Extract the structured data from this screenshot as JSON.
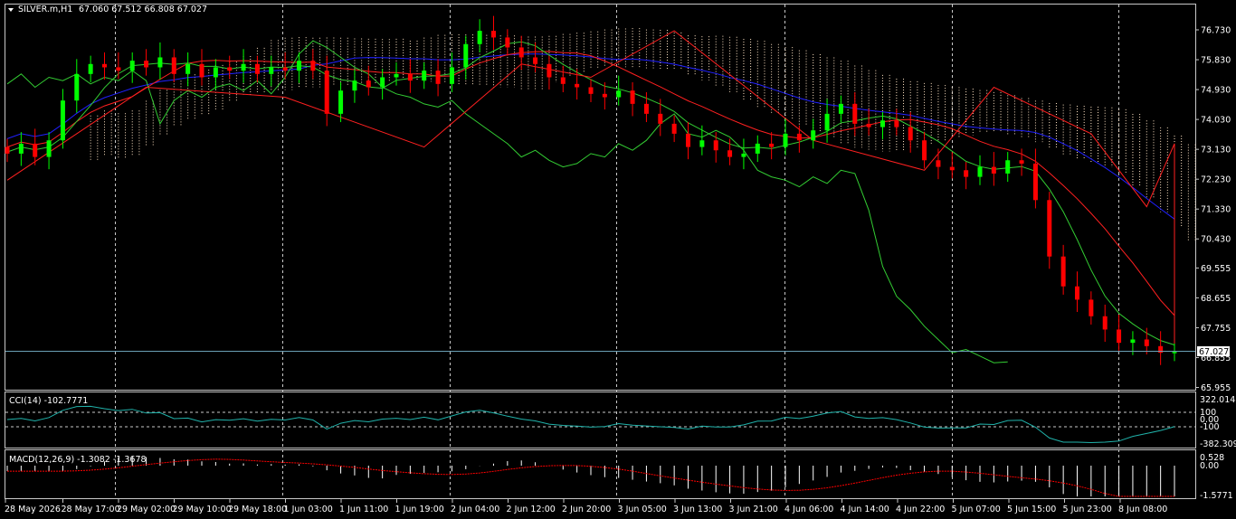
{
  "header": {
    "symbol": "SILVER.m,H1",
    "ohlc": "67.060 67.512 66.808 67.027",
    "menu_icon": "triangle-down-icon"
  },
  "price_axis": {
    "labels": [
      "76.730",
      "75.830",
      "74.930",
      "74.030",
      "73.130",
      "72.230",
      "71.330",
      "70.430",
      "69.555",
      "68.655",
      "67.755",
      "66.855",
      "65.955"
    ],
    "current": "67.027"
  },
  "cci": {
    "title": "CCI(14) -102.7771",
    "labels": [
      "322.0148",
      "100",
      "0.00",
      "-100",
      "-382.309"
    ]
  },
  "macd": {
    "title": "MACD(12,26,9) -1.3082 -1.3678",
    "labels": [
      "0.528",
      "0.00",
      "-1.5771"
    ]
  },
  "time_axis": {
    "labels": [
      "28 May 2026",
      "28 May 17:00",
      "29 May 02:00",
      "29 May 10:00",
      "29 May 18:00",
      "1 Jun 03:00",
      "1 Jun 11:00",
      "1 Jun 19:00",
      "2 Jun 04:00",
      "2 Jun 12:00",
      "2 Jun 20:00",
      "3 Jun 05:00",
      "3 Jun 13:00",
      "3 Jun 21:00",
      "4 Jun 06:00",
      "4 Jun 14:00",
      "4 Jun 22:00",
      "5 Jun 07:00",
      "5 Jun 15:00",
      "5 Jun 23:00",
      "8 Jun 08:00"
    ]
  },
  "colors": {
    "background": "#000000",
    "bull": "#00ff00",
    "bear": "#ff0000",
    "grid": "#c8c8c8",
    "cloud": "#ffe4c4",
    "line_blue": "#2020ff",
    "line_red": "#ff2020",
    "line_green": "#33cc33",
    "cci": "#20b2aa",
    "macd_hist": "#ffffff",
    "macd_signal": "#ff0000",
    "current_line": "#6a9fb5"
  },
  "chart_data": {
    "type": "candlestick",
    "instrument": "SILVER.m",
    "timeframe": "H1",
    "close": [
      73.0,
      73.3,
      72.9,
      73.4,
      74.6,
      75.4,
      75.7,
      75.6,
      75.5,
      75.8,
      75.6,
      75.9,
      75.4,
      75.7,
      75.3,
      75.6,
      75.5,
      75.7,
      75.4,
      75.6,
      75.5,
      75.8,
      75.5,
      74.2,
      74.9,
      75.2,
      75.0,
      75.3,
      75.4,
      75.2,
      75.5,
      75.1,
      75.6,
      76.3,
      76.7,
      76.5,
      76.2,
      75.9,
      75.7,
      75.3,
      75.1,
      75.0,
      74.8,
      74.7,
      74.9,
      74.5,
      74.2,
      73.9,
      73.6,
      73.2,
      73.4,
      73.1,
      72.9,
      73.0,
      73.3,
      73.2,
      73.6,
      73.4,
      73.7,
      74.2,
      74.5,
      73.9,
      73.8,
      74.0,
      73.8,
      73.4,
      72.8,
      72.6,
      72.5,
      72.3,
      72.6,
      72.4,
      72.8,
      72.7,
      71.6,
      69.9,
      69.0,
      68.6,
      68.1,
      67.7,
      67.3,
      67.4,
      67.2,
      67.0,
      67.027
    ]
  }
}
